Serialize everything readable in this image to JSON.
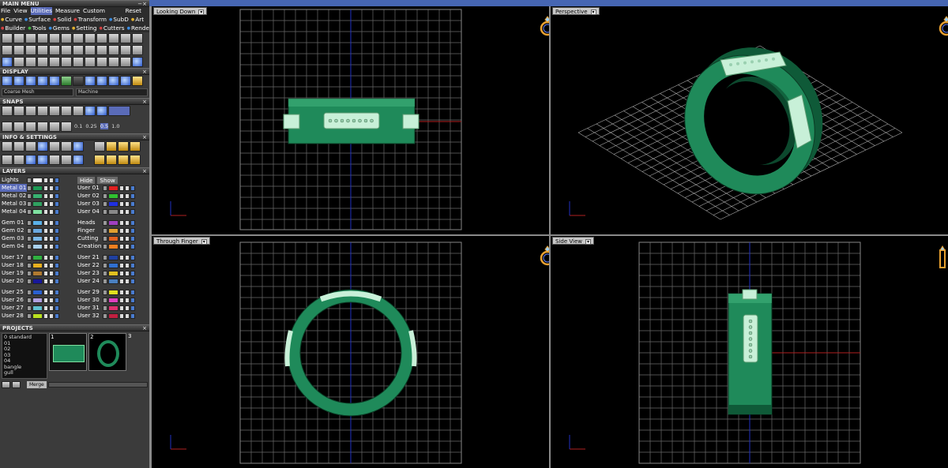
{
  "menu": {
    "title": "MAIN MENU",
    "items": [
      "File",
      "View",
      "Utilities",
      "Measure",
      "Custom"
    ],
    "reset": "Reset",
    "tabs": [
      "Curve",
      "Surface",
      "Solid",
      "Transform",
      "SubD",
      "Art"
    ],
    "tabs2": [
      "Builder",
      "Tools",
      "Gems",
      "Setting",
      "Cutters",
      "Render"
    ]
  },
  "sections": {
    "display": "DISPLAY",
    "snaps": "SNAPS",
    "info": "INFO & SETTINGS",
    "layers": "LAYERS",
    "projects": "PROJECTS"
  },
  "display": {
    "mesh": "Coarse Mesh",
    "mode": "Machine"
  },
  "snaps": {
    "values": [
      "0.1",
      "0.25",
      "0.5",
      "1.0"
    ]
  },
  "layers": {
    "lights": "Lights",
    "hide": "Hide",
    "show": "Show",
    "left_groups": [
      [
        {
          "name": "Metal 01",
          "color": "#1f9a55"
        },
        {
          "name": "Metal 02",
          "color": "#38b070"
        },
        {
          "name": "Metal 03",
          "color": "#30a060"
        },
        {
          "name": "Metal 04",
          "color": "#7fe0a0"
        }
      ],
      [
        {
          "name": "Gem 01",
          "color": "#5ab0e8"
        },
        {
          "name": "Gem 02",
          "color": "#6aa8e0"
        },
        {
          "name": "Gem 03",
          "color": "#7ab8e8"
        },
        {
          "name": "Gem 04",
          "color": "#a8d0f0"
        }
      ],
      [
        {
          "name": "User 17",
          "color": "#30b040"
        },
        {
          "name": "User 18",
          "color": "#e8b020"
        },
        {
          "name": "User 19",
          "color": "#b07a30"
        },
        {
          "name": "User 20",
          "color": "#18189a"
        }
      ],
      [
        {
          "name": "User 25",
          "color": "#2a60d0"
        },
        {
          "name": "User 26",
          "color": "#b0a0e0"
        },
        {
          "name": "User 27",
          "color": "#60c0d0"
        },
        {
          "name": "User 28",
          "color": "#b8e020"
        }
      ]
    ],
    "right_groups": [
      [
        {
          "name": "User 01",
          "color": "#e02020"
        },
        {
          "name": "User 02",
          "color": "#30c030"
        },
        {
          "name": "User 03",
          "color": "#2030e0"
        },
        {
          "name": "User 04",
          "color": "#888888"
        }
      ],
      [
        {
          "name": "Heads",
          "color": "#a040c0"
        },
        {
          "name": "Finger",
          "color": "#e0a030"
        },
        {
          "name": "Cutting",
          "color": "#e06020"
        },
        {
          "name": "Creation",
          "color": "#f08020"
        }
      ],
      [
        {
          "name": "User 21",
          "color": "#2040a0"
        },
        {
          "name": "User 22",
          "color": "#3070d0"
        },
        {
          "name": "User 23",
          "color": "#e0c020"
        },
        {
          "name": "User 24",
          "color": "#4a80c0"
        }
      ],
      [
        {
          "name": "User 29",
          "color": "#e0e020"
        },
        {
          "name": "User 30",
          "color": "#e040c0"
        },
        {
          "name": "User 31",
          "color": "#e03070"
        },
        {
          "name": "User 32",
          "color": "#c02040"
        }
      ]
    ]
  },
  "projects": {
    "list": [
      "0 standard",
      "01",
      "02",
      "03",
      "04",
      "bangle",
      "gull"
    ],
    "thumbs": [
      "1",
      "2",
      "3"
    ],
    "merge": "Merge"
  },
  "viewports": [
    {
      "label": "Looking Down",
      "view": "top"
    },
    {
      "label": "Perspective",
      "view": "perspective"
    },
    {
      "label": "Through Finger",
      "view": "front"
    },
    {
      "label": "Side View",
      "view": "side"
    }
  ],
  "colors": {
    "metal": "#1f8a5a",
    "metal_light": "#6fe0a8",
    "gem": "#c8f0d8",
    "grid": "#6a6a6a",
    "axis_x": "#b02020",
    "axis_y": "#2030c0",
    "selection": "#5a6bb8"
  }
}
